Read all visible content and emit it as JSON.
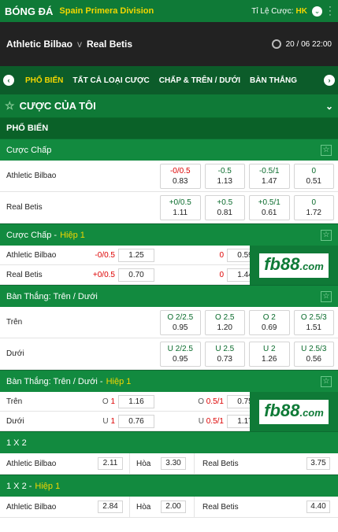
{
  "header": {
    "title": "BÓNG ĐÁ",
    "league": "Spain Primera Division",
    "odds_label": "Tỉ Lệ Cược:",
    "odds_type": "HK"
  },
  "match": {
    "home": "Athletic Bilbao",
    "vs": "v",
    "away": "Real Betis",
    "datetime": "20 / 06 22:00"
  },
  "tabs": [
    "PHỔ BIẾN",
    "TẤT CẢ LOẠI CƯỢC",
    "CHẤP & TRÊN / DƯỚI",
    "BÀN THẮNG"
  ],
  "mybets": "CƯỢC CỦA TÔI",
  "popular": "PHỔ BIẾN",
  "handicap": {
    "title": "Cược Chấp",
    "rows": [
      {
        "team": "Athletic Bilbao",
        "cells": [
          [
            "-0/0.5",
            "0.83",
            true
          ],
          [
            "-0.5",
            "1.13",
            false
          ],
          [
            "-0.5/1",
            "1.47",
            false
          ],
          [
            "0",
            "0.51",
            false
          ]
        ]
      },
      {
        "team": "Real Betis",
        "cells": [
          [
            "+0/0.5",
            "1.11",
            false
          ],
          [
            "+0.5",
            "0.81",
            false
          ],
          [
            "+0.5/1",
            "0.61",
            false
          ],
          [
            "0",
            "1.72",
            false
          ]
        ]
      }
    ]
  },
  "handicap_h1": {
    "title": "Cược Chấp -",
    "half": "Hiệp 1",
    "rows": [
      {
        "team": "Athletic Bilbao",
        "h": "-0/0.5",
        "o": "1.25",
        "z": "0",
        "o2": "0.59"
      },
      {
        "team": "Real Betis",
        "h": "+0/0.5",
        "o": "0.70",
        "z": "0",
        "o2": "1.44"
      }
    ]
  },
  "ou": {
    "title": "Bàn Thắng: Trên / Dưới",
    "rows": [
      {
        "team": "Trên",
        "cells": [
          [
            "O 2/2.5",
            "0.95"
          ],
          [
            "O 2.5",
            "1.20"
          ],
          [
            "O 2",
            "0.69"
          ],
          [
            "O 2.5/3",
            "1.51"
          ]
        ]
      },
      {
        "team": "Dưới",
        "cells": [
          [
            "U 2/2.5",
            "0.95"
          ],
          [
            "U 2.5",
            "0.73"
          ],
          [
            "U 2",
            "1.26"
          ],
          [
            "U 2.5/3",
            "0.56"
          ]
        ]
      }
    ]
  },
  "ou_h1": {
    "title": "Bàn Thắng: Trên / Dưới -",
    "half": "Hiệp 1",
    "rows": [
      {
        "team": "Trên",
        "l": "O",
        "n": "1",
        "o": "1.16",
        "l2": "O",
        "n2": "0.5/1",
        "o2": "0.75"
      },
      {
        "team": "Dưới",
        "l": "U",
        "n": "1",
        "o": "0.76",
        "l2": "U",
        "n2": "0.5/1",
        "o2": "1.17"
      }
    ]
  },
  "x12": {
    "title": "1 X 2",
    "home": "Athletic Bilbao",
    "h": "2.11",
    "draw": "Hòa",
    "d": "3.30",
    "away": "Real Betis",
    "a": "3.75"
  },
  "x12_h1": {
    "title": "1 X 2 -",
    "half": "Hiệp 1",
    "home": "Athletic Bilbao",
    "h": "2.84",
    "draw": "Hòa",
    "d": "2.00",
    "away": "Real Betis",
    "a": "4.40"
  },
  "ad": {
    "brand": "fb88",
    "tld": ".com"
  }
}
